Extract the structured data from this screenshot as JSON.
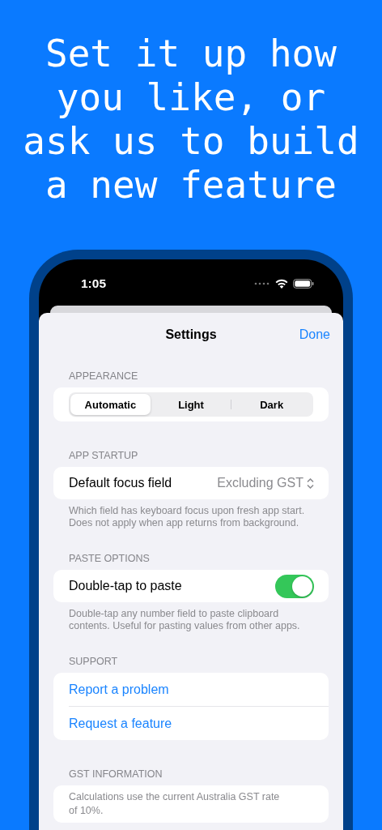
{
  "headline": "Set it up how you like, or ask us to build a new feature",
  "status_bar": {
    "time": "1:05"
  },
  "nav": {
    "title": "Settings",
    "done": "Done"
  },
  "appearance": {
    "header": "APPEARANCE",
    "segments": [
      {
        "label": "Automatic",
        "selected": true
      },
      {
        "label": "Light",
        "selected": false
      },
      {
        "label": "Dark",
        "selected": false
      }
    ]
  },
  "app_startup": {
    "header": "APP STARTUP",
    "row": {
      "label": "Default focus field",
      "value": "Excluding GST"
    },
    "footer": "Which field has keyboard focus upon fresh app start. Does not apply when app returns from background."
  },
  "paste_options": {
    "header": "PASTE OPTIONS",
    "row": {
      "label": "Double-tap to paste",
      "on": true
    },
    "footer": "Double-tap any number field to paste clipboard contents. Useful for pasting values from other apps."
  },
  "support": {
    "header": "SUPPORT",
    "links": [
      "Report a problem",
      "Request a feature"
    ]
  },
  "gst_information": {
    "header": "GST INFORMATION",
    "text": "Calculations use the current Australia GST rate of 10%."
  }
}
